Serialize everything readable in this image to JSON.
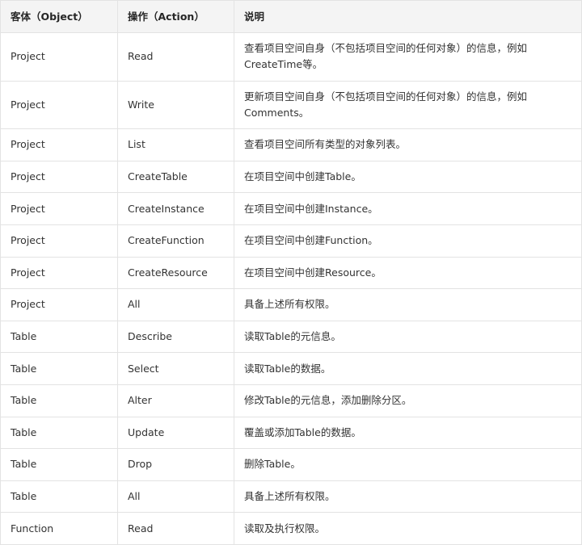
{
  "table": {
    "headers": [
      "客体（Object）",
      "操作（Action）",
      "说明"
    ],
    "rows": [
      {
        "object": "Project",
        "action": "Read",
        "description": "查看项目空间自身（不包括项目空间的任何对象）的信息，例如CreateTime等。"
      },
      {
        "object": "Project",
        "action": "Write",
        "description": "更新项目空间自身（不包括项目空间的任何对象）的信息，例如Comments。"
      },
      {
        "object": "Project",
        "action": "List",
        "description": "查看项目空间所有类型的对象列表。"
      },
      {
        "object": "Project",
        "action": "CreateTable",
        "description": "在项目空间中创建Table。"
      },
      {
        "object": "Project",
        "action": "CreateInstance",
        "description": "在项目空间中创建Instance。"
      },
      {
        "object": "Project",
        "action": "CreateFunction",
        "description": "在项目空间中创建Function。"
      },
      {
        "object": "Project",
        "action": "CreateResource",
        "description": "在项目空间中创建Resource。"
      },
      {
        "object": "Project",
        "action": "All",
        "description": "具备上述所有权限。"
      },
      {
        "object": "Table",
        "action": "Describe",
        "description": "读取Table的元信息。"
      },
      {
        "object": "Table",
        "action": "Select",
        "description": "读取Table的数据。"
      },
      {
        "object": "Table",
        "action": "Alter",
        "description": "修改Table的元信息，添加删除分区。"
      },
      {
        "object": "Table",
        "action": "Update",
        "description": "覆盖或添加Table的数据。"
      },
      {
        "object": "Table",
        "action": "Drop",
        "description": "删除Table。"
      },
      {
        "object": "Table",
        "action": "All",
        "description": "具备上述所有权限。"
      },
      {
        "object": "Function",
        "action": "Read",
        "description": "读取及执行权限。"
      }
    ]
  }
}
